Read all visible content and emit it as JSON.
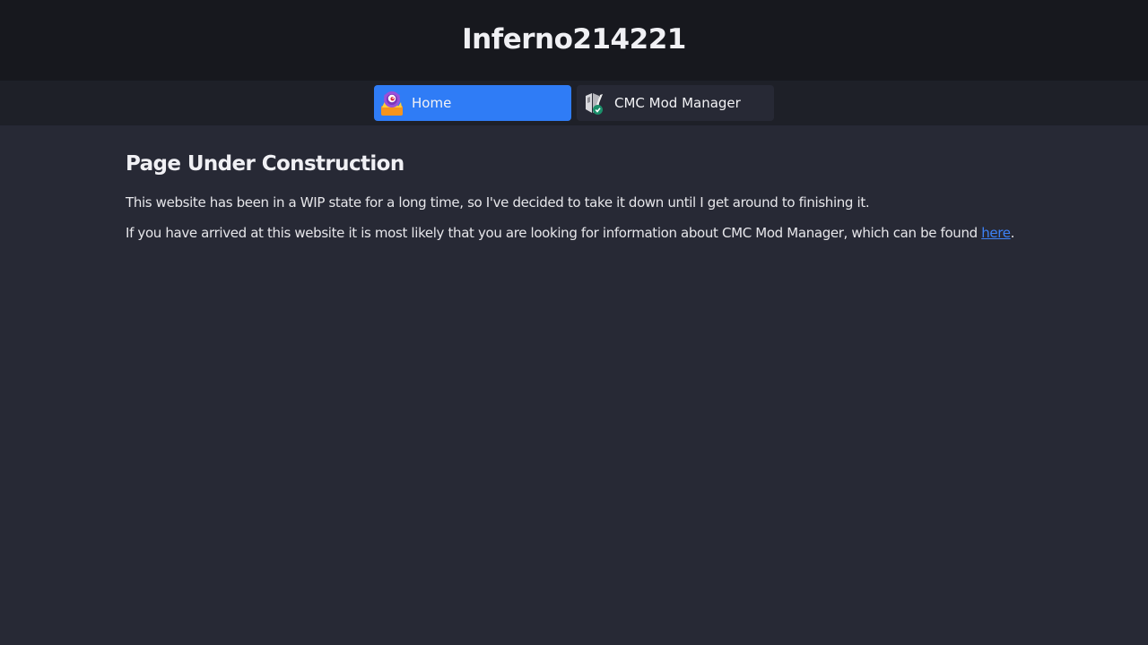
{
  "header": {
    "title": "Inferno214221"
  },
  "nav": {
    "tabs": [
      {
        "label": "Home",
        "icon": "inferno-fire-icon",
        "active": true
      },
      {
        "label": "CMC Mod Manager",
        "icon": "cmc-mod-manager-icon",
        "active": false
      }
    ]
  },
  "main": {
    "heading": "Page Under Construction",
    "paragraph1": "This website has been in a WIP state for a long time, so I've decided to take it down until I get around to finishing it.",
    "paragraph2_prefix": "If you have arrived at this website it is most likely that you are looking for information about CMC Mod Manager, which can be found ",
    "paragraph2_link": "here",
    "paragraph2_suffix": "."
  },
  "colors": {
    "header_bg": "#17181e",
    "nav_bg": "#1e2028",
    "page_bg": "#272935",
    "accent": "#2f7cf6",
    "link": "#3d82f7"
  }
}
